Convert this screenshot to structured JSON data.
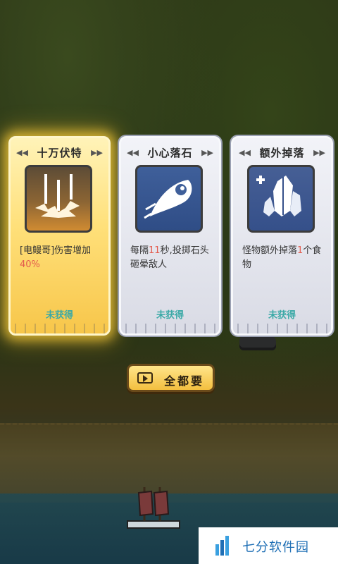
{
  "cards": [
    {
      "title": "十万伏特",
      "icon": "lightning-strike-icon",
      "desc_parts": [
        "[电鳗哥]伤害增加",
        "40%",
        ""
      ],
      "status": "未获得",
      "selected": true
    },
    {
      "title": "小心落石",
      "icon": "falling-rock-icon",
      "desc_parts": [
        "每隔",
        "11",
        "秒,投掷石头砸晕敌人"
      ],
      "status": "未获得",
      "selected": false
    },
    {
      "title": "额外掉落",
      "icon": "crystal-plus-icon",
      "desc_parts": [
        "怪物额外掉落",
        "1",
        "个食物"
      ],
      "status": "未获得",
      "selected": false
    }
  ],
  "action_button": {
    "label": "全都要",
    "icon": "video-camera-icon"
  },
  "watermark": {
    "text": "七分软件园",
    "icon": "logo-bars-icon"
  },
  "colors": {
    "highlight": "#e35b4e",
    "status": "#3aa9a6",
    "gold": "#ffe07a"
  }
}
